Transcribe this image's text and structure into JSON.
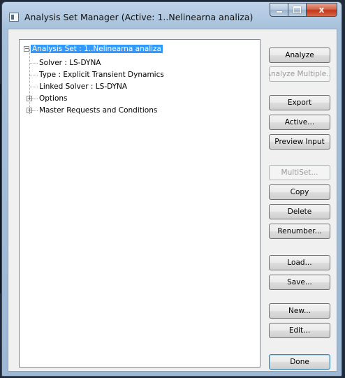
{
  "window": {
    "title": "Analysis Set Manager (Active: 1..Nelinearna analiza)",
    "close_glyph": "x"
  },
  "tree": {
    "root": "Analysis Set : 1..Nelinearna analiza",
    "children": [
      "Solver : LS-DYNA",
      "Type : Explicit Transient Dynamics",
      "Linked Solver : LS-DYNA",
      "Options",
      "Master Requests and Conditions"
    ]
  },
  "buttons": {
    "analyze": "Analyze",
    "analyze_multiple": "Analyze Multiple...",
    "export": "Export",
    "active": "Active...",
    "preview_input": "Preview Input",
    "multiset": "MultiSet...",
    "copy": "Copy",
    "delete": "Delete",
    "renumber": "Renumber...",
    "load": "Load...",
    "save": "Save...",
    "new": "New...",
    "edit": "Edit...",
    "done": "Done"
  },
  "colors": {
    "selection": "#3399ff",
    "close_button": "#c2361a"
  }
}
